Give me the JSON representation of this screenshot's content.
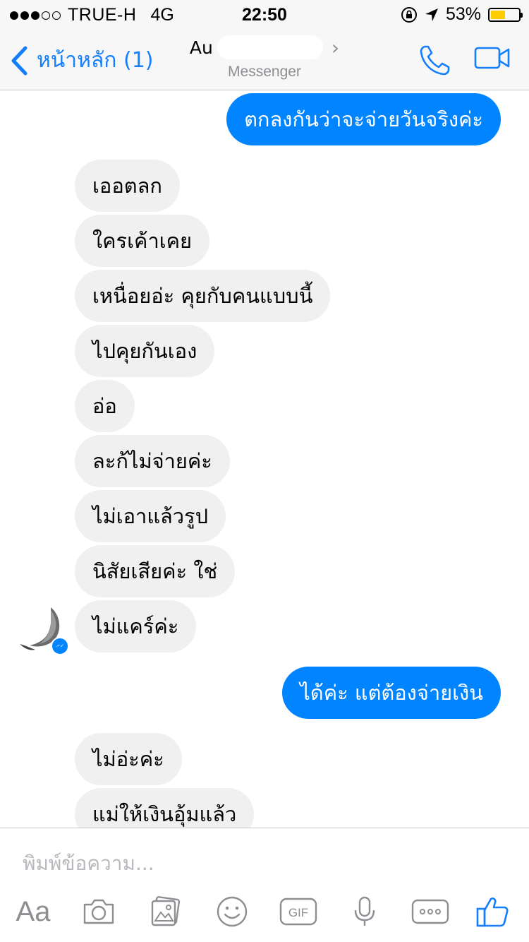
{
  "status_bar": {
    "carrier": "TRUE-H",
    "network": "4G",
    "time": "22:50",
    "battery": "53%",
    "battery_level": 0.53,
    "signal_bars": 3
  },
  "nav": {
    "back_label": "หน้าหลัก (1)",
    "contact_name": "Au",
    "contact_subtitle": "Messenger"
  },
  "messages": [
    {
      "direction": "out",
      "text": "ตกลงกันว่าจะจ่ายวันจริงค่ะ"
    },
    {
      "direction": "in",
      "text": "เออตลก"
    },
    {
      "direction": "in",
      "text": "ใครเค้าเคย"
    },
    {
      "direction": "in",
      "text": "เหนื่อยอ่ะ คุยกับคนแบบนี้"
    },
    {
      "direction": "in",
      "text": "ไปคุยกันเอง"
    },
    {
      "direction": "in",
      "text": "อ่อ"
    },
    {
      "direction": "in",
      "text": "ละก้ไม่จ่ายค่ะ"
    },
    {
      "direction": "in",
      "text": "ไม่เอาแล้วรูป"
    },
    {
      "direction": "in",
      "text": "นิสัยเสียค่ะ ใช่"
    },
    {
      "direction": "in",
      "text": "ไม่แคร์ค่ะ"
    },
    {
      "direction": "out",
      "text": "ได้ค่ะ แต่ต้องจ่ายเงิน"
    },
    {
      "direction": "in",
      "text": "ไม่อ่ะค่ะ"
    },
    {
      "direction": "in",
      "text": "แม่ให้เงินอุ้มแล้ว"
    }
  ],
  "composer": {
    "placeholder": "พิมพ์ข้อความ...",
    "aa_label": "Aa",
    "gif_label": "GIF",
    "tools": [
      "aa-icon",
      "camera-icon",
      "gallery-icon",
      "emoji-icon",
      "gif-icon",
      "microphone-icon",
      "more-icon",
      "like-icon"
    ]
  },
  "colors": {
    "accent": "#147efb",
    "outgoing_bubble": "#0084ff",
    "incoming_bubble": "#f1f0f0",
    "battery": "#ffcc00"
  }
}
